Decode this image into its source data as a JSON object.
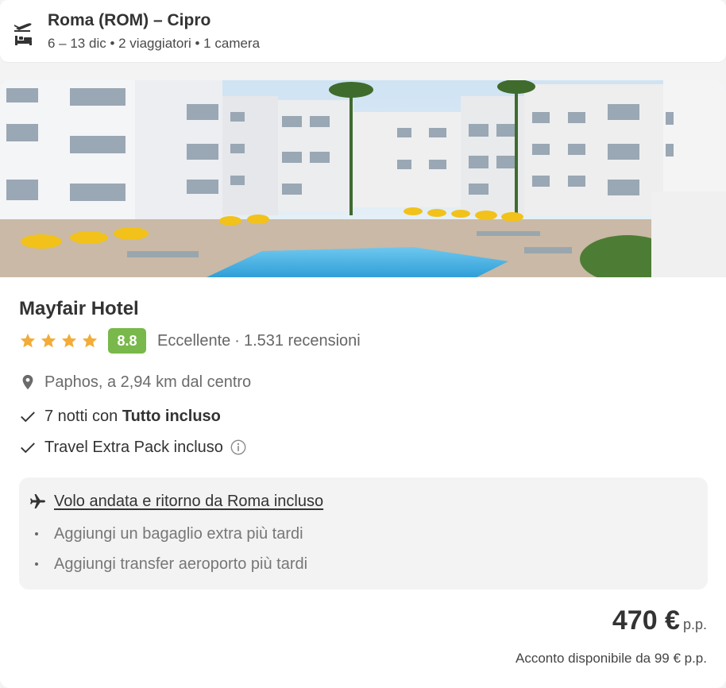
{
  "search": {
    "title": "Roma (ROM) – Cipro",
    "subtitle": "6 – 13 dic • 2 viaggiatori • 1 camera",
    "icon": "flight-and-hotel-icon"
  },
  "hotel": {
    "name": "Mayfair Hotel",
    "stars": 4,
    "score": "8.8",
    "score_label": "Eccellente",
    "reviews": "1.531 recensioni",
    "location": "Paphos, a 2,94 km dal centro",
    "features": {
      "nights_prefix": "7 notti con ",
      "nights_bold": "Tutto incluso",
      "extra_pack": "Travel Extra Pack incluso"
    },
    "flight": {
      "heading": "Volo andata e ritorno da Roma incluso",
      "items": [
        "Aggiungi un bagaglio extra più tardi",
        "Aggiungi transfer aeroporto più tardi"
      ]
    },
    "price": {
      "amount": "470 €",
      "unit": "p.p.",
      "deposit": "Acconto disponibile da 99 € p.p."
    }
  },
  "colors": {
    "score_badge": "#79b84a",
    "star": "#f2ac37",
    "text_primary": "#333333",
    "background": "#f3f3f3"
  }
}
